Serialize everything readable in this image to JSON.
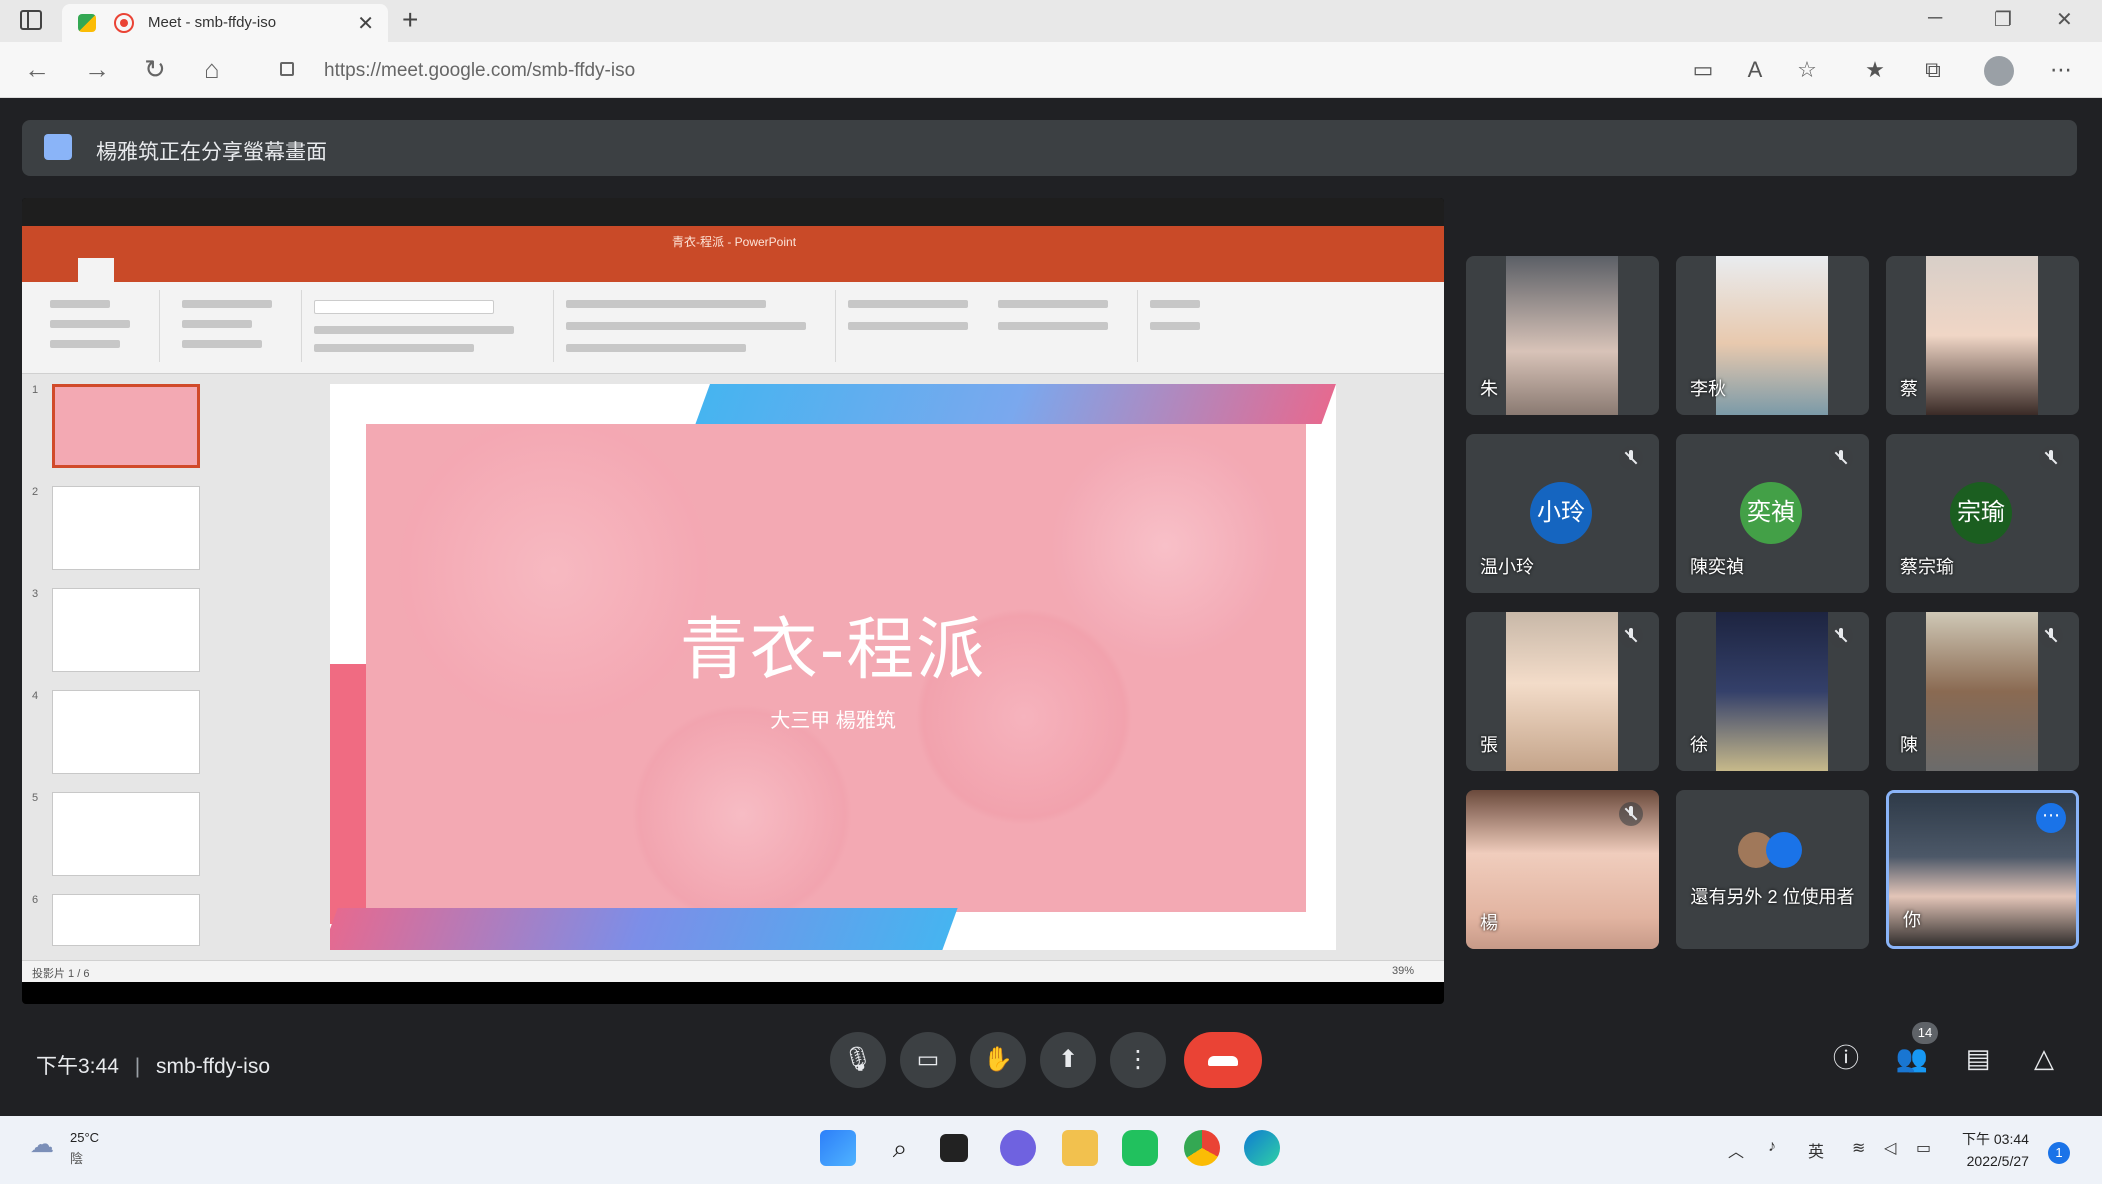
{
  "browser": {
    "tab_title": "Meet - smb-ffdy-iso",
    "url": "https://meet.google.com/smb-ffdy-iso"
  },
  "meet": {
    "presenting_banner": "楊雅筑正在分享螢幕畫面",
    "slide": {
      "app_title": "青衣-程派 - PowerPoint",
      "title": "青衣-程派",
      "subtitle": "大三甲 楊雅筑",
      "status_text": "投影片 1 / 6",
      "zoom": "39%"
    },
    "participants": [
      {
        "name": "朱",
        "type": "video",
        "muted": false
      },
      {
        "name": "李秋",
        "type": "video",
        "muted": false
      },
      {
        "name": "蔡",
        "type": "video",
        "muted": false
      },
      {
        "name": "温小玲",
        "type": "avatar",
        "initials": "小玲",
        "color": "#1565c0",
        "muted": true
      },
      {
        "name": "陳奕禎",
        "type": "avatar",
        "initials": "奕禎",
        "color": "#43a047",
        "muted": true
      },
      {
        "name": "蔡宗瑜",
        "type": "avatar",
        "initials": "宗瑜",
        "color": "#1b5e20",
        "muted": true
      },
      {
        "name": "張",
        "type": "video",
        "muted": true
      },
      {
        "name": "徐",
        "type": "video",
        "muted": true
      },
      {
        "name": "陳",
        "type": "video",
        "muted": true
      },
      {
        "name": "楊",
        "type": "video",
        "muted": true
      },
      {
        "name": "還有另外 2 位使用者",
        "type": "others",
        "muted": false
      },
      {
        "name": "你",
        "type": "video",
        "muted": false,
        "self": true
      }
    ],
    "meeting_time": "下午3:44",
    "meeting_code": "smb-ffdy-iso",
    "people_count": "14"
  },
  "taskbar": {
    "weather_temp": "25°C",
    "weather_desc": "陰",
    "ime": "英",
    "time": "下午 03:44",
    "date": "2022/5/27",
    "notification_count": "1"
  },
  "colors": {
    "meet_bg": "#202124",
    "tile_bg": "#3c4043",
    "hangup": "#ea4335",
    "ppt_accent": "#c94a28",
    "slide_pink": "#f3a9b3"
  }
}
